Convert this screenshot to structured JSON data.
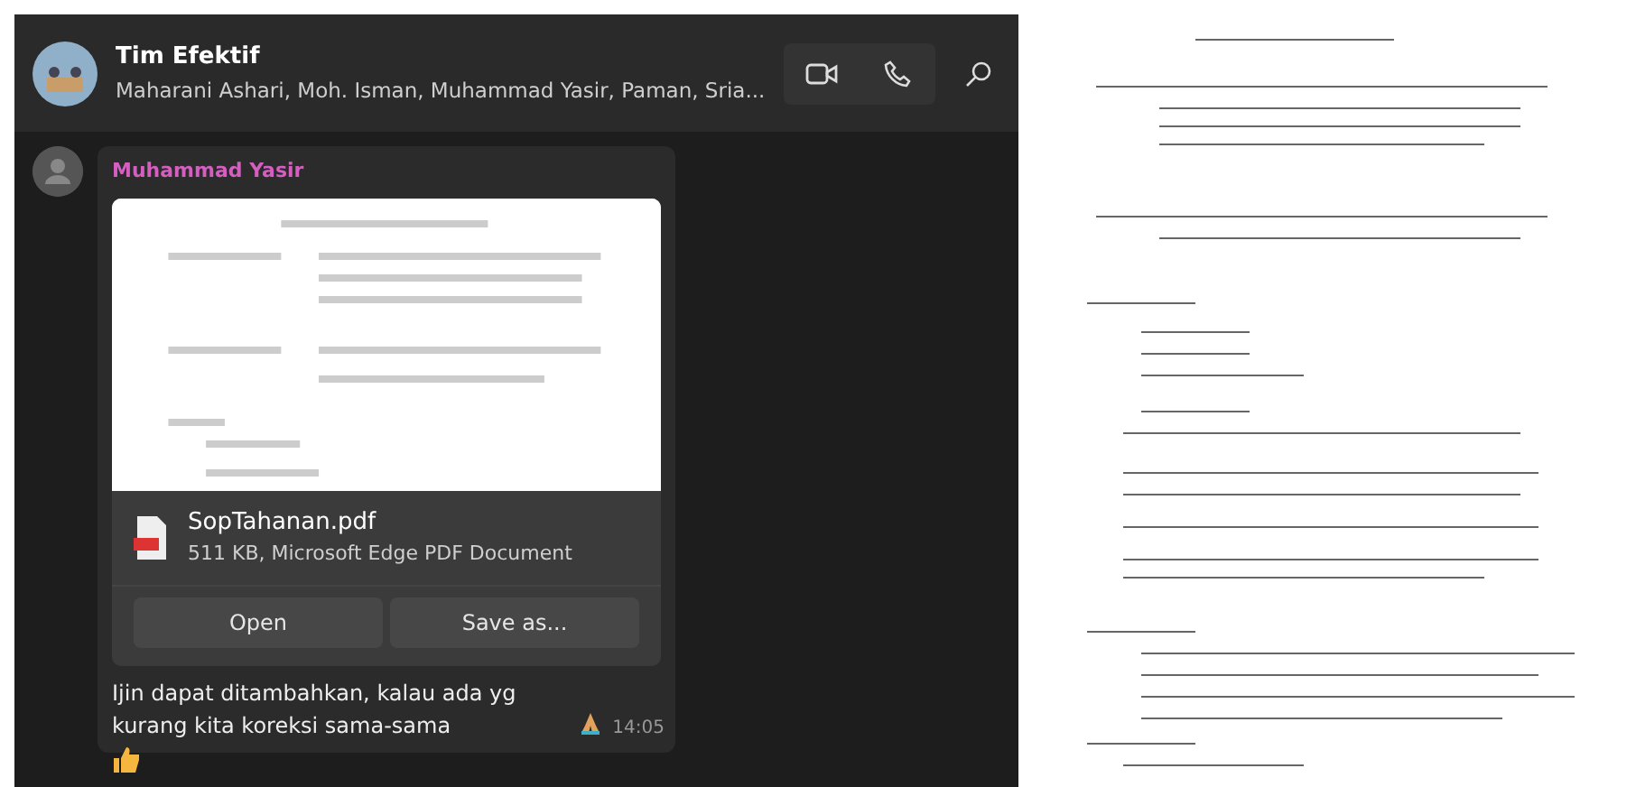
{
  "chat_header": {
    "title": "Tim Efektif",
    "members": "Maharani Ashari, Moh. Isman, Muhammad Yasir, Paman, Sria..."
  },
  "message": {
    "sender": "Muhammad Yasir",
    "attachment": {
      "file_name": "SopTahanan.pdf",
      "file_info": "511 KB, Microsoft Edge PDF Document",
      "actions": [
        "Open",
        "Save as..."
      ]
    },
    "text": "Ijin dapat ditambahkan, kalau ada yg kurang kita koreksi sama-sama",
    "time": "14:05"
  }
}
